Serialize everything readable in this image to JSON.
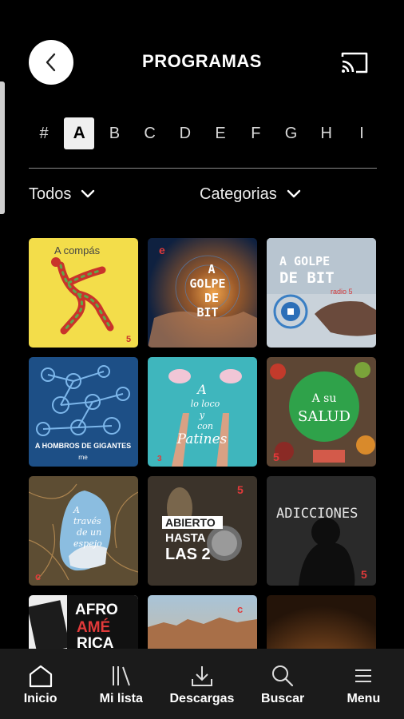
{
  "header": {
    "title": "PROGRAMAS",
    "back_icon": "chevron-left-icon",
    "cast_icon": "cast-icon"
  },
  "alphabet": {
    "letters": [
      "#",
      "A",
      "B",
      "C",
      "D",
      "E",
      "F",
      "G",
      "H",
      "I"
    ],
    "selected": "A"
  },
  "filters": {
    "all_label": "Todos",
    "category_label": "Categorias"
  },
  "programs": [
    {
      "title_lines": [
        "A compás"
      ],
      "badge": "5",
      "bg": "#f3dd4a"
    },
    {
      "title_lines": [
        "A",
        "GOLPE",
        "DE",
        "BIT"
      ],
      "badge": "e",
      "bg": "#13284a"
    },
    {
      "title_lines": [
        "A GOLPE",
        "DE BIT"
      ],
      "badge": "radio 5",
      "bg": "#c9d2da"
    },
    {
      "title_lines": [
        "A HOMBROS DE GIGANTES"
      ],
      "badge": "rne",
      "bg": "#1d4f86"
    },
    {
      "title_lines": [
        "A",
        "lo loco",
        "y",
        "con",
        "Patines"
      ],
      "badge": "3",
      "bg": "#3fb6bd"
    },
    {
      "title_lines": [
        "A su",
        "SALUD"
      ],
      "badge": "5",
      "bg": "#5d4634"
    },
    {
      "title_lines": [
        "A",
        "través",
        "de un",
        "espejo"
      ],
      "badge": "c",
      "bg": "#5d4d33"
    },
    {
      "title_lines": [
        "ABIERTO",
        "HASTA",
        "LAS 2"
      ],
      "badge": "5",
      "bg": "#3b332a"
    },
    {
      "title_lines": [
        "ADICCIONES"
      ],
      "badge": "5",
      "bg": "#2a2a2a"
    },
    {
      "title_lines": [
        "AFRO",
        "AMÉ",
        "RICA"
      ],
      "badge": "",
      "bg": "#ededed"
    },
    {
      "title_lines": [],
      "badge": "c",
      "bg": "#c98a5a"
    },
    {
      "title_lines": [],
      "badge": "",
      "bg": "#4a2f17"
    }
  ],
  "nav": {
    "items": [
      {
        "label": "Inicio",
        "icon": "home-icon"
      },
      {
        "label": "Mi lista",
        "icon": "library-icon"
      },
      {
        "label": "Descargas",
        "icon": "download-icon"
      },
      {
        "label": "Buscar",
        "icon": "search-icon"
      },
      {
        "label": "Menu",
        "icon": "menu-icon"
      }
    ]
  }
}
